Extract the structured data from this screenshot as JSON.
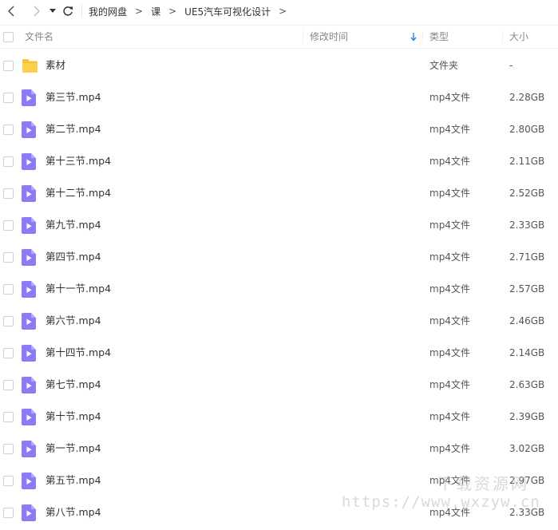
{
  "breadcrumb": {
    "items": [
      "我的网盘",
      "课",
      "UE5汽车可视化设计"
    ],
    "separator": ">"
  },
  "columns": {
    "name": "文件名",
    "modified": "修改时间",
    "type": "类型",
    "size": "大小"
  },
  "files": [
    {
      "name": "素材",
      "type": "文件夹",
      "size": "-",
      "icon": "folder-icon"
    },
    {
      "name": "第三节.mp4",
      "type": "mp4文件",
      "size": "2.28GB",
      "icon": "video-file-icon"
    },
    {
      "name": "第二节.mp4",
      "type": "mp4文件",
      "size": "2.80GB",
      "icon": "video-file-icon"
    },
    {
      "name": "第十三节.mp4",
      "type": "mp4文件",
      "size": "2.11GB",
      "icon": "video-file-icon"
    },
    {
      "name": "第十二节.mp4",
      "type": "mp4文件",
      "size": "2.52GB",
      "icon": "video-file-icon"
    },
    {
      "name": "第九节.mp4",
      "type": "mp4文件",
      "size": "2.33GB",
      "icon": "video-file-icon"
    },
    {
      "name": "第四节.mp4",
      "type": "mp4文件",
      "size": "2.71GB",
      "icon": "video-file-icon"
    },
    {
      "name": "第十一节.mp4",
      "type": "mp4文件",
      "size": "2.57GB",
      "icon": "video-file-icon"
    },
    {
      "name": "第六节.mp4",
      "type": "mp4文件",
      "size": "2.46GB",
      "icon": "video-file-icon"
    },
    {
      "name": "第十四节.mp4",
      "type": "mp4文件",
      "size": "2.14GB",
      "icon": "video-file-icon"
    },
    {
      "name": "第七节.mp4",
      "type": "mp4文件",
      "size": "2.63GB",
      "icon": "video-file-icon"
    },
    {
      "name": "第十节.mp4",
      "type": "mp4文件",
      "size": "2.39GB",
      "icon": "video-file-icon"
    },
    {
      "name": "第一节.mp4",
      "type": "mp4文件",
      "size": "3.02GB",
      "icon": "video-file-icon"
    },
    {
      "name": "第五节.mp4",
      "type": "mp4文件",
      "size": "2.97GB",
      "icon": "video-file-icon"
    },
    {
      "name": "第八节.mp4",
      "type": "mp4文件",
      "size": "2.33GB",
      "icon": "video-file-icon"
    }
  ],
  "watermark": {
    "text": "下载资源网",
    "url": "https://www.wxzyw.cn"
  },
  "colors": {
    "accent": "#1e88e5",
    "folder": "#f7c33d",
    "video_icon": "#8b7cf6"
  }
}
